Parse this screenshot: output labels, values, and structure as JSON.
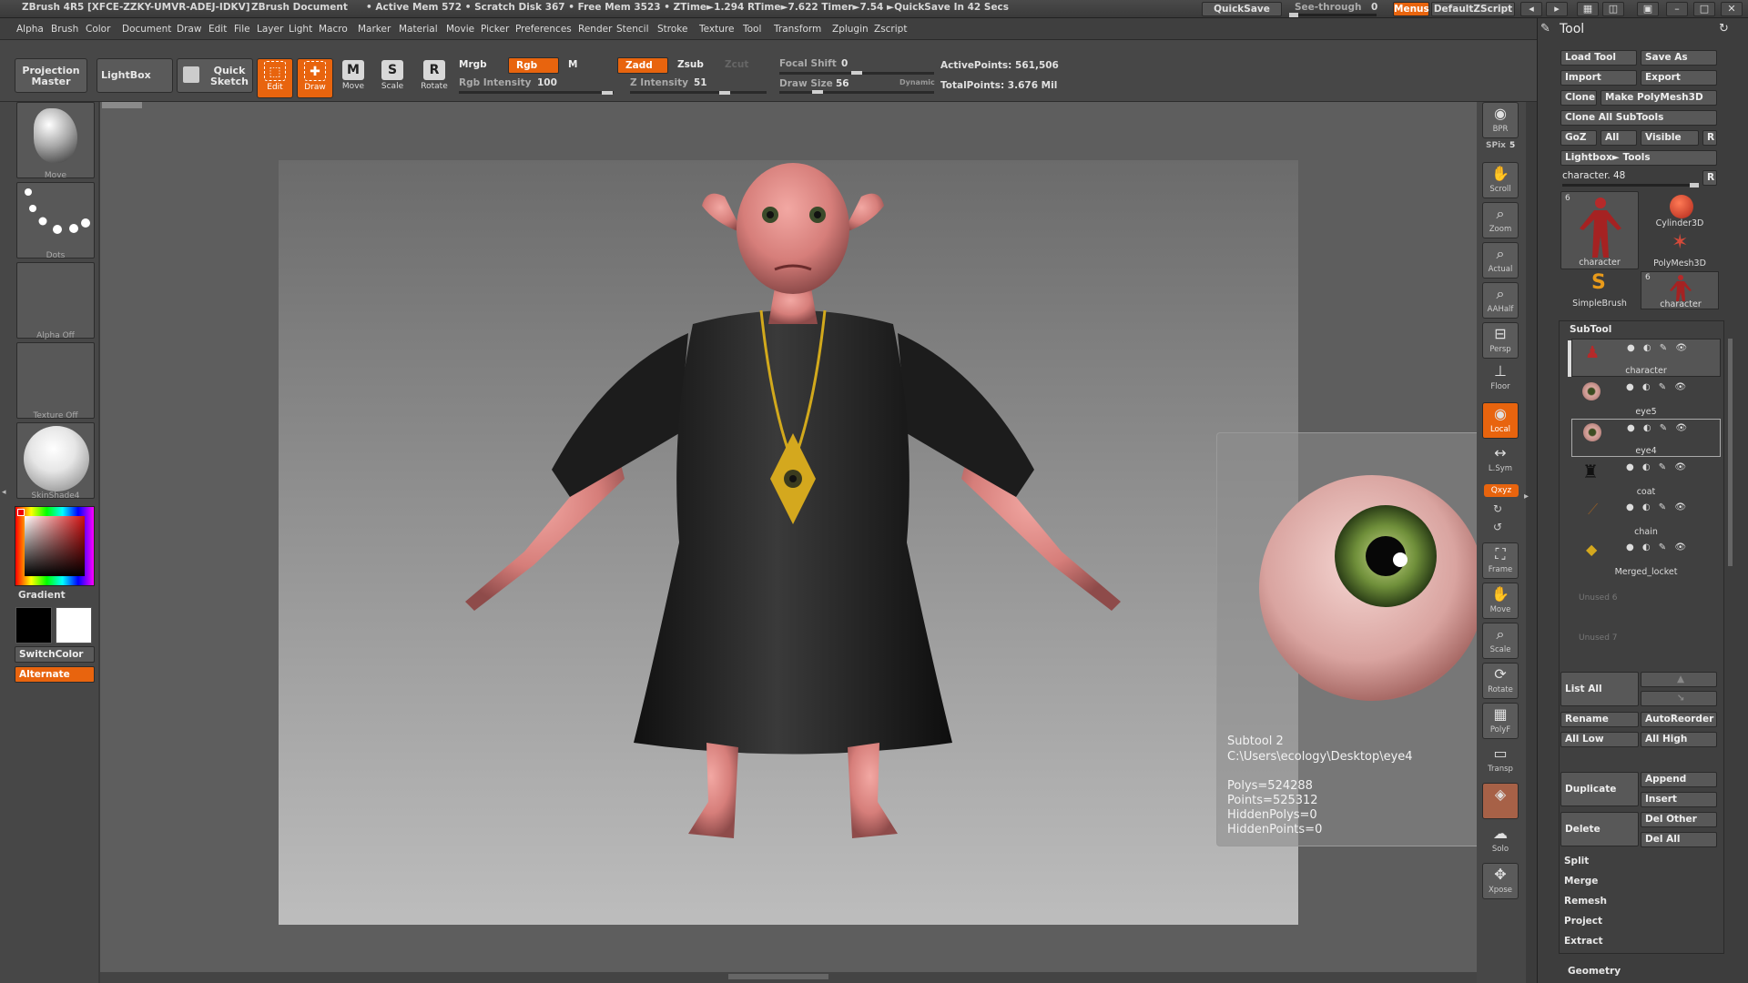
{
  "titlebar": {
    "app": "ZBrush 4R5 [XFCE-ZZKY-UMVR-ADEJ-IDKV]",
    "document": "ZBrush Document",
    "stats": "• Active Mem 572 • Scratch Disk 367 • Free Mem 3523 • ZTime►1.294 RTime►7.622 Timer►7.54 ►QuickSave In 42 Secs",
    "quicksave": "QuickSave",
    "seethrough": "See-through",
    "seethrough_value": "0",
    "menus": "Menus",
    "script": "DefaultZScript",
    "accent": "#e8640e"
  },
  "menubar": {
    "items": [
      "Alpha",
      "Brush",
      "Color",
      "Document",
      "Draw",
      "Edit",
      "File",
      "Layer",
      "Light",
      "Macro",
      "Marker",
      "Material",
      "Movie",
      "Picker",
      "Preferences",
      "Render",
      "Stencil",
      "Stroke",
      "Texture",
      "Tool",
      "Transform",
      "Zplugin",
      "Zscript"
    ]
  },
  "toolbar": {
    "projection_master": "Projection Master",
    "lightbox": "LightBox",
    "quick_sketch": "Quick Sketch",
    "edit": "Edit",
    "draw": "Draw",
    "move": "Move",
    "scale": "Scale",
    "rotate": "Rotate",
    "mrgb": "Mrgb",
    "rgb": "Rgb",
    "m": "M",
    "rgb_intensity_label": "Rgb Intensity",
    "rgb_intensity": "100",
    "zadd": "Zadd",
    "zsub": "Zsub",
    "zcut": "Zcut",
    "z_intensity_label": "Z Intensity",
    "z_intensity": "51",
    "focal_shift_label": "Focal Shift",
    "focal_shift": "0",
    "draw_size_label": "Draw Size",
    "draw_size": "56",
    "dynamic": "Dynamic",
    "active_points": "ActivePoints: 561,506",
    "total_points": "TotalPoints: 3.676 Mil"
  },
  "leftshelf": {
    "brush": "Move",
    "stroke": "Dots",
    "alpha": "Alpha Off",
    "texture": "Texture Off",
    "material": "SkinShade4",
    "gradient": "Gradient",
    "switchcolor": "SwitchColor",
    "alternate": "Alternate"
  },
  "rightstrip": {
    "bpr": "BPR",
    "spix_label": "SPix",
    "spix": "5",
    "scroll": "Scroll",
    "zoom": "Zoom",
    "actual": "Actual",
    "aahalf": "AAHalf",
    "persp": "Persp",
    "floor": "Floor",
    "local": "Local",
    "lsym": "L.Sym",
    "xyz": "Qxyz",
    "frame": "Frame",
    "move": "Move",
    "scale": "Scale",
    "rotate": "Rotate",
    "polyf": "PolyF",
    "transp": "Transp",
    "solo": "Solo",
    "xpose": "Xpose"
  },
  "palette": {
    "title": "Tool",
    "load_tool": "Load Tool",
    "save_as": "Save As",
    "import": "Import",
    "export": "Export",
    "clone": "Clone",
    "make_polymesh": "Make PolyMesh3D",
    "clone_all": "Clone All SubTools",
    "goz": "GoZ",
    "all": "All",
    "visible": "Visible",
    "r": "R",
    "lightbox_tools": "Lightbox► Tools",
    "character_slider": "character. 48",
    "tools": [
      {
        "name": "character",
        "count": "6"
      },
      {
        "name": "Cylinder3D",
        "count": ""
      },
      {
        "name": "PolyMesh3D",
        "count": ""
      },
      {
        "name": "SimpleBrush",
        "count": ""
      },
      {
        "name": "character",
        "count": "6"
      }
    ],
    "subtool_header": "SubTool",
    "subtools": [
      "character",
      "eye5",
      "eye4",
      "coat",
      "chain",
      "Merged_locket",
      "Unused 6",
      "Unused 7"
    ],
    "list_all": "List All",
    "rename": "Rename",
    "autoreorder": "AutoReorder",
    "all_low": "All Low",
    "all_high": "All High",
    "duplicate": "Duplicate",
    "append": "Append",
    "insert": "Insert",
    "delete": "Delete",
    "del_other": "Del Other",
    "del_all": "Del All",
    "split": "Split",
    "merge": "Merge",
    "remesh": "Remesh",
    "project": "Project",
    "extract": "Extract",
    "geometry": "Geometry"
  },
  "info": {
    "subtool": "Subtool 2",
    "path": "C:\\Users\\ecology\\Desktop\\eye4",
    "polys": "Polys=524288",
    "points": "Points=525312",
    "hidden_polys": "HiddenPolys=0",
    "hidden_points": "HiddenPoints=0"
  }
}
